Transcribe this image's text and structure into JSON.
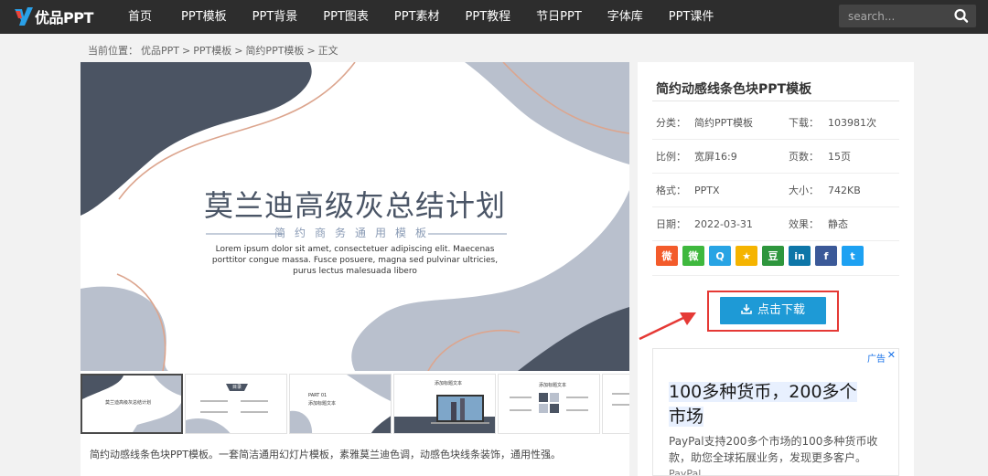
{
  "site": {
    "logo_text": "优品PPT"
  },
  "nav": {
    "items": [
      "首页",
      "PPT模板",
      "PPT背景",
      "PPT图表",
      "PPT素材",
      "PPT教程",
      "节日PPT",
      "字体库",
      "PPT课件"
    ],
    "search_placeholder": "search..."
  },
  "breadcrumb": {
    "prefix": "当前位置：",
    "items": [
      "优品PPT",
      ">",
      "PPT模板",
      ">",
      "简约PPT模板",
      ">",
      "正文"
    ]
  },
  "preview": {
    "title": "莫兰迪高级灰总结计划",
    "subtitle": "简约商务通用模板",
    "lorem": "Lorem ipsum dolor sit amet, consectetuer adipiscing elit. Maecenas porttitor congue massa. Fusce posuere, magna sed pulvinar ultricies, purus lectus malesuada libero"
  },
  "thumbs": {
    "t1": "莫兰迪高级灰总结计划",
    "t2": "目录",
    "t3": "PART 01",
    "t3b": "添加标题文本",
    "t4": "添加标题文本",
    "t5": "添加标题文本"
  },
  "description": "简约动感线条色块PPT模板。一套简洁通用幻灯片模板，素雅莫兰迪色调，动感色块线条装饰，通用性强。",
  "sidebar": {
    "title": "简约动感线条色块PPT模板",
    "rows": [
      {
        "k1": "分类：",
        "v1": "简约PPT模板",
        "k2": "下载：",
        "v2": "103981次"
      },
      {
        "k1": "比例：",
        "v1": "宽屏16:9",
        "k2": "页数：",
        "v2": "15页"
      },
      {
        "k1": "格式：",
        "v1": "PPTX",
        "k2": "大小：",
        "v2": "742KB"
      },
      {
        "k1": "日期：",
        "v1": "2022-03-31",
        "k2": "效果：",
        "v2": "静态"
      }
    ],
    "share": [
      {
        "name": "weibo",
        "glyph": "微",
        "color": "#f35b2b"
      },
      {
        "name": "wechat",
        "glyph": "微",
        "color": "#3fb83e"
      },
      {
        "name": "qq",
        "glyph": "Q",
        "color": "#28a4e4"
      },
      {
        "name": "qzone",
        "glyph": "★",
        "color": "#f5b400"
      },
      {
        "name": "douban",
        "glyph": "豆",
        "color": "#2e963d"
      },
      {
        "name": "linkedin",
        "glyph": "in",
        "color": "#0e76a8"
      },
      {
        "name": "facebook",
        "glyph": "f",
        "color": "#3b5998"
      },
      {
        "name": "twitter",
        "glyph": "t",
        "color": "#1da1f2"
      }
    ],
    "download_label": "点击下载"
  },
  "ad": {
    "label": "广告",
    "close": "✕",
    "headline_l1": "100多种货币，200多个",
    "headline_l2": "市场",
    "body": "PayPal支持200多个市场的100多种货币收款，助您全球拓展业务，发现更多客户。",
    "brand": "PayPal"
  }
}
